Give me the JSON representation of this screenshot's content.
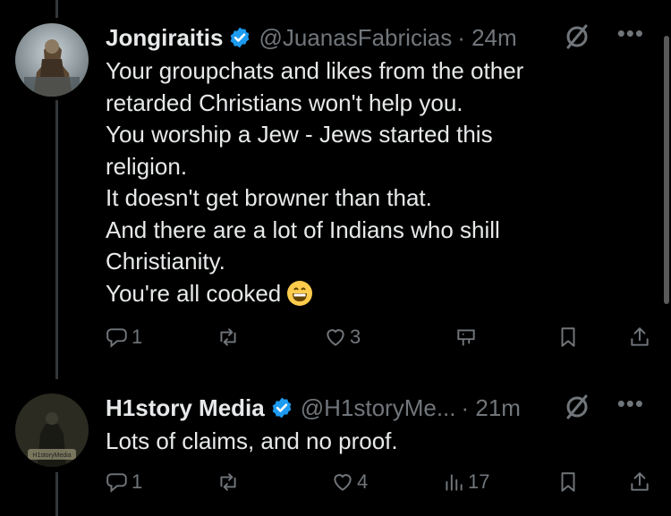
{
  "tweets": [
    {
      "name": "Jongiraitis",
      "handle": "@JuanasFabricias",
      "time": "· 24m",
      "more": "•••",
      "lines": [
        "Your groupchats and likes from the other",
        "retarded Christians won't help you.",
        "You worship a Jew - Jews started this",
        "religion.",
        "It doesn't get browner than that.",
        "And there are a lot of Indians who shill",
        "Christianity.",
        "You're all cooked"
      ],
      "reply_count": "1",
      "repost_count": "",
      "like_count": "3",
      "views_count": ""
    },
    {
      "name": "H1story Media",
      "handle": "@H1storyMe...",
      "time": "· 21m",
      "more": "•••",
      "lines": [
        "Lots of claims, and no proof."
      ],
      "reply_count": "1",
      "repost_count": "",
      "like_count": "4",
      "views_count": "17",
      "avatar_text": "H1storyMedia"
    }
  ],
  "colors": {
    "background": "#000000",
    "text": "#e7e9ea",
    "muted": "#71767b",
    "verified": "#1d9bf0"
  },
  "icons": [
    "verified-badge-icon",
    "grok-icon",
    "more-icon",
    "reply-icon",
    "repost-icon",
    "like-icon",
    "views-icon",
    "analytics-icon",
    "bookmark-icon",
    "share-icon",
    "grinning-emoji-icon"
  ]
}
